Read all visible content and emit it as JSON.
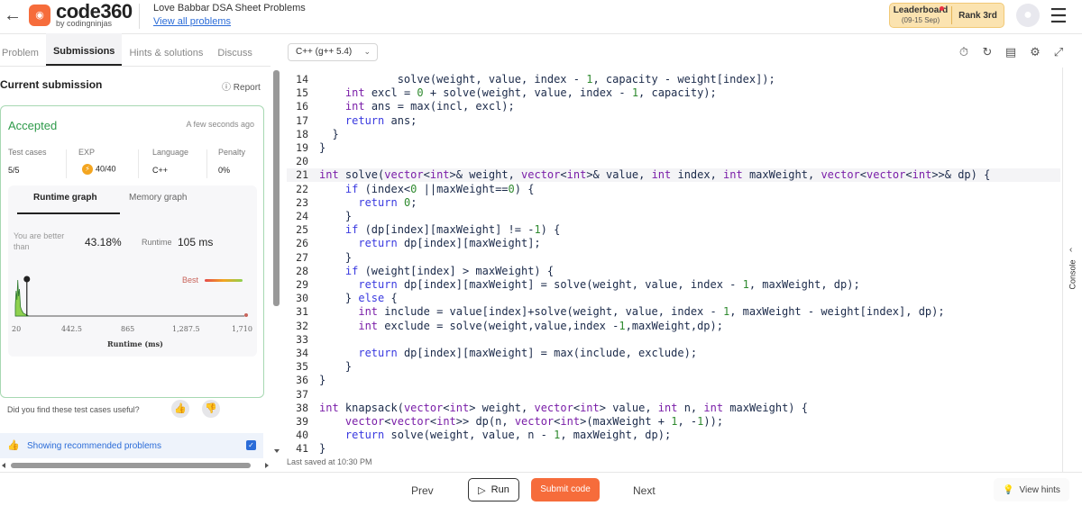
{
  "header": {
    "logo_text": "code360",
    "logo_sub": "by codingninjas",
    "breadcrumb_title": "Love Babbar DSA Sheet Problems",
    "breadcrumb_link": "View all problems",
    "leaderboard_label": "Leaderboard",
    "leaderboard_dates": "(09-15 Sep)",
    "rank_label": "Rank 3rd"
  },
  "tabs": [
    "Problem",
    "Submissions",
    "Hints & solutions",
    "Discuss"
  ],
  "language_select": "C++ (g++ 5.4)",
  "submission": {
    "title": "Current submission",
    "report": "Report",
    "status": "Accepted",
    "time_ago": "A few seconds ago",
    "stats": [
      {
        "label": "Test cases",
        "value": "5/5"
      },
      {
        "label": "EXP",
        "value": "40/40"
      },
      {
        "label": "Language",
        "value": "C++"
      },
      {
        "label": "Penalty",
        "value": "0%"
      }
    ],
    "graph_tabs": [
      "Runtime graph",
      "Memory graph"
    ],
    "better_than_label": "You are better than",
    "better_than_value": "43.18%",
    "runtime_label": "Runtime",
    "runtime_value": "105 ms",
    "best_label": "Best",
    "useful_question": "Did you find these test cases useful?",
    "recommended": "Showing recommended problems"
  },
  "chart_data": {
    "type": "area",
    "xlabel": "Runtime (ms)",
    "x_ticks": [
      "20",
      "442.5",
      "865",
      "1,287.5",
      "1,710"
    ],
    "xlim": [
      20,
      1710
    ],
    "marker_x": 105
  },
  "code_lines": [
    {
      "n": "14",
      "t": "            solve(weight, value, index - 1, capacity - weight[index]);"
    },
    {
      "n": "15",
      "t": "    int excl = 0 + solve(weight, value, index - 1, capacity);"
    },
    {
      "n": "16",
      "t": "    int ans = max(incl, excl);"
    },
    {
      "n": "17",
      "t": "    return ans;"
    },
    {
      "n": "18",
      "t": "  }"
    },
    {
      "n": "19",
      "t": "}"
    },
    {
      "n": "20",
      "t": ""
    },
    {
      "n": "21",
      "t": "int solve(vector<int>& weight, vector<int>& value, int index, int maxWeight, vector<vector<int>>& dp) {"
    },
    {
      "n": "22",
      "t": "    if (index<0 ||maxWeight==0) {"
    },
    {
      "n": "23",
      "t": "      return 0;"
    },
    {
      "n": "24",
      "t": "    }"
    },
    {
      "n": "25",
      "t": "    if (dp[index][maxWeight] != -1) {"
    },
    {
      "n": "26",
      "t": "      return dp[index][maxWeight];"
    },
    {
      "n": "27",
      "t": "    }"
    },
    {
      "n": "28",
      "t": "    if (weight[index] > maxWeight) {"
    },
    {
      "n": "29",
      "t": "      return dp[index][maxWeight] = solve(weight, value, index - 1, maxWeight, dp);"
    },
    {
      "n": "30",
      "t": "    } else {"
    },
    {
      "n": "31",
      "t": "      int include = value[index]+solve(weight, value, index - 1, maxWeight - weight[index], dp);"
    },
    {
      "n": "32",
      "t": "      int exclude = solve(weight,value,index -1,maxWeight,dp);"
    },
    {
      "n": "33",
      "t": ""
    },
    {
      "n": "34",
      "t": "      return dp[index][maxWeight] = max(include, exclude);"
    },
    {
      "n": "35",
      "t": "    }"
    },
    {
      "n": "36",
      "t": "}"
    },
    {
      "n": "37",
      "t": ""
    },
    {
      "n": "38",
      "t": "int knapsack(vector<int> weight, vector<int> value, int n, int maxWeight) {"
    },
    {
      "n": "39",
      "t": "    vector<vector<int>> dp(n, vector<int>(maxWeight + 1, -1));"
    },
    {
      "n": "40",
      "t": "    return solve(weight, value, n - 1, maxWeight, dp);"
    },
    {
      "n": "41",
      "t": "}"
    }
  ],
  "highlight_line": "21",
  "last_saved": "Last saved at 10:30 PM",
  "footer": {
    "prev": "Prev",
    "run": "Run",
    "submit": "Submit code",
    "next": "Next",
    "hints": "View hints"
  },
  "side_panel": "Console",
  "colors": {
    "accent": "#f66c3b",
    "accepted": "#2e9a4a",
    "link": "#2b6cd8"
  }
}
